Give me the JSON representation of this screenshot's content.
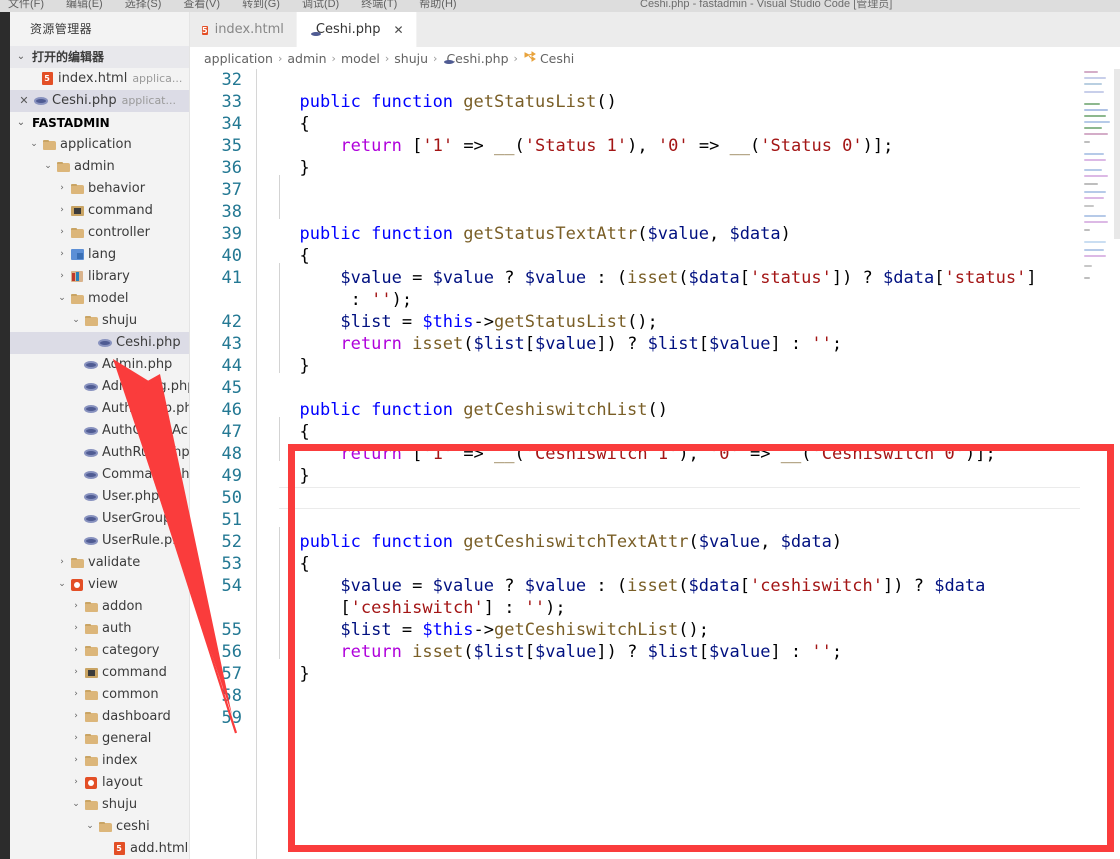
{
  "window": {
    "menus": [
      "文件(F)",
      "编辑(E)",
      "选择(S)",
      "查看(V)",
      "转到(G)",
      "调试(D)",
      "终端(T)",
      "帮助(H)"
    ],
    "title": "Ceshi.php - fastadmin - Visual Studio Code [管理员]"
  },
  "sidebar": {
    "title": "资源管理器",
    "open_editors": {
      "label": "打开的编辑器",
      "twisty": "⌄",
      "items": [
        {
          "name": "index.html",
          "desc": "applica...",
          "icon": "html-icon",
          "closed": false,
          "selected": false
        },
        {
          "name": "Ceshi.php",
          "desc": "applicat...",
          "icon": "php-icon",
          "closed": true,
          "selected": true
        }
      ]
    },
    "project": {
      "label": "FASTADMIN",
      "twisty": "⌄",
      "items": [
        {
          "label": "application",
          "icon": "folder-icon",
          "twisty": "⌄",
          "indent": 1,
          "selected": false
        },
        {
          "label": "admin",
          "icon": "folder-icon",
          "twisty": "⌄",
          "indent": 2,
          "selected": false
        },
        {
          "label": "behavior",
          "icon": "folder-icon",
          "twisty": "›",
          "indent": 3,
          "selected": false
        },
        {
          "label": "command",
          "icon": "command-folder-icon",
          "twisty": "›",
          "indent": 3,
          "selected": false
        },
        {
          "label": "controller",
          "icon": "folder-icon",
          "twisty": "›",
          "indent": 3,
          "selected": false
        },
        {
          "label": "lang",
          "icon": "lang-folder-icon",
          "twisty": "›",
          "indent": 3,
          "selected": false
        },
        {
          "label": "library",
          "icon": "library-folder-icon",
          "twisty": "›",
          "indent": 3,
          "selected": false
        },
        {
          "label": "model",
          "icon": "folder-icon",
          "twisty": "⌄",
          "indent": 3,
          "selected": false
        },
        {
          "label": "shuju",
          "icon": "folder-icon",
          "twisty": "⌄",
          "indent": 4,
          "selected": false
        },
        {
          "label": "Ceshi.php",
          "icon": "php-icon",
          "twisty": "",
          "indent": 5,
          "selected": true
        },
        {
          "label": "Admin.php",
          "icon": "php-icon",
          "twisty": "",
          "indent": 4,
          "selected": false
        },
        {
          "label": "AdminLog.php",
          "icon": "php-icon",
          "twisty": "",
          "indent": 4,
          "selected": false
        },
        {
          "label": "AuthGroup.php",
          "icon": "php-icon",
          "twisty": "",
          "indent": 4,
          "selected": false
        },
        {
          "label": "AuthGroupAc...",
          "icon": "php-icon",
          "twisty": "",
          "indent": 4,
          "selected": false
        },
        {
          "label": "AuthRule.php",
          "icon": "php-icon",
          "twisty": "",
          "indent": 4,
          "selected": false
        },
        {
          "label": "Command.php",
          "icon": "php-icon",
          "twisty": "",
          "indent": 4,
          "selected": false
        },
        {
          "label": "User.php",
          "icon": "php-icon",
          "twisty": "",
          "indent": 4,
          "selected": false
        },
        {
          "label": "UserGroup.php",
          "icon": "php-icon",
          "twisty": "",
          "indent": 4,
          "selected": false
        },
        {
          "label": "UserRule.php",
          "icon": "php-icon",
          "twisty": "",
          "indent": 4,
          "selected": false
        },
        {
          "label": "validate",
          "icon": "folder-icon",
          "twisty": "›",
          "indent": 3,
          "selected": false
        },
        {
          "label": "view",
          "icon": "view-folder-icon",
          "twisty": "⌄",
          "indent": 3,
          "selected": false
        },
        {
          "label": "addon",
          "icon": "folder-icon",
          "twisty": "›",
          "indent": 4,
          "selected": false
        },
        {
          "label": "auth",
          "icon": "folder-icon",
          "twisty": "›",
          "indent": 4,
          "selected": false
        },
        {
          "label": "category",
          "icon": "folder-icon",
          "twisty": "›",
          "indent": 4,
          "selected": false
        },
        {
          "label": "command",
          "icon": "command-folder-icon",
          "twisty": "›",
          "indent": 4,
          "selected": false
        },
        {
          "label": "common",
          "icon": "folder-icon",
          "twisty": "›",
          "indent": 4,
          "selected": false
        },
        {
          "label": "dashboard",
          "icon": "folder-icon",
          "twisty": "›",
          "indent": 4,
          "selected": false
        },
        {
          "label": "general",
          "icon": "folder-icon",
          "twisty": "›",
          "indent": 4,
          "selected": false
        },
        {
          "label": "index",
          "icon": "folder-icon",
          "twisty": "›",
          "indent": 4,
          "selected": false
        },
        {
          "label": "layout",
          "icon": "view-folder-icon",
          "twisty": "›",
          "indent": 4,
          "selected": false
        },
        {
          "label": "shuju",
          "icon": "folder-icon",
          "twisty": "⌄",
          "indent": 4,
          "selected": false
        },
        {
          "label": "ceshi",
          "icon": "folder-icon",
          "twisty": "⌄",
          "indent": 5,
          "selected": false
        },
        {
          "label": "add.html",
          "icon": "html-icon",
          "twisty": "",
          "indent": 6,
          "selected": false
        }
      ]
    }
  },
  "tabs": [
    {
      "label": "index.html",
      "icon": "html-icon",
      "active": false,
      "closable": false
    },
    {
      "label": "Ceshi.php",
      "icon": "php-icon",
      "active": true,
      "closable": true,
      "close_glyph": "✕"
    }
  ],
  "breadcrumb": {
    "separator": "›",
    "items": [
      {
        "label": "application",
        "icon": ""
      },
      {
        "label": "admin",
        "icon": ""
      },
      {
        "label": "model",
        "icon": ""
      },
      {
        "label": "shuju",
        "icon": ""
      },
      {
        "label": "Ceshi.php",
        "icon": "php-icon"
      },
      {
        "label": "Ceshi",
        "icon": "class-icon"
      }
    ]
  },
  "editor": {
    "first_line": 32,
    "last_line": 59,
    "line_numbers": [
      32,
      33,
      34,
      35,
      36,
      37,
      38,
      39,
      40,
      41,
      42,
      43,
      44,
      45,
      46,
      47,
      48,
      49,
      50,
      51,
      52,
      53,
      54,
      55,
      56,
      57,
      58,
      59
    ],
    "lines": [
      {
        "n": 32,
        "text": ""
      },
      {
        "n": 33,
        "text": "    public function getStatusList()"
      },
      {
        "n": 34,
        "text": "    {"
      },
      {
        "n": 35,
        "text": "        return ['1' => __('Status 1'), '0' => __('Status 0')];"
      },
      {
        "n": 36,
        "text": "    }"
      },
      {
        "n": 37,
        "text": ""
      },
      {
        "n": 38,
        "text": ""
      },
      {
        "n": 39,
        "text": "    public function getStatusTextAttr($value, $data)"
      },
      {
        "n": 40,
        "text": "    {"
      },
      {
        "n": 41,
        "text": "        $value = $value ? $value : (isset($data['status']) ? $data['status'] : '');"
      },
      {
        "n": 42,
        "text": "        $list = $this->getStatusList();"
      },
      {
        "n": 43,
        "text": "        return isset($list[$value]) ? $list[$value] : '';"
      },
      {
        "n": 44,
        "text": "    }"
      },
      {
        "n": 45,
        "text": ""
      },
      {
        "n": 46,
        "text": "    public function getCeshiswitchList()"
      },
      {
        "n": 47,
        "text": "    {"
      },
      {
        "n": 48,
        "text": "        return ['1' => __('Ceshiswitch 1'), '0' => __('Ceshiswitch 0')];"
      },
      {
        "n": 49,
        "text": "    }"
      },
      {
        "n": 50,
        "text": ""
      },
      {
        "n": 51,
        "text": ""
      },
      {
        "n": 52,
        "text": "    public function getCeshiswitchTextAttr($value, $data)"
      },
      {
        "n": 53,
        "text": "    {"
      },
      {
        "n": 54,
        "text": "        $value = $value ? $value : (isset($data['ceshiswitch']) ? $data['ceshiswitch'] : '');"
      },
      {
        "n": 55,
        "text": "        $list = $this->getCeshiswitchList();"
      },
      {
        "n": 56,
        "text": "        return isset($list[$value]) ? $list[$value] : '';"
      },
      {
        "n": 57,
        "text": "    }"
      },
      {
        "n": 58,
        "text": ""
      },
      {
        "n": 59,
        "text": ""
      }
    ]
  },
  "annotations": {
    "highlight_box": {
      "color": "#fa3c3c",
      "border_width": 7
    },
    "arrow": {
      "color": "#fa3c3c",
      "from": "line-54-gutter",
      "to": "sidebar-item-ceshi-php"
    }
  },
  "colors": {
    "keyword": "#0000ff",
    "function": "#795e26",
    "string": "#a31515",
    "variable": "#001080",
    "control": "#af00db",
    "line_number": "#237893",
    "sidebar_bg": "#f3f3f3",
    "selection_bg": "#dcdce6",
    "accent_red": "#fa3c3c"
  }
}
